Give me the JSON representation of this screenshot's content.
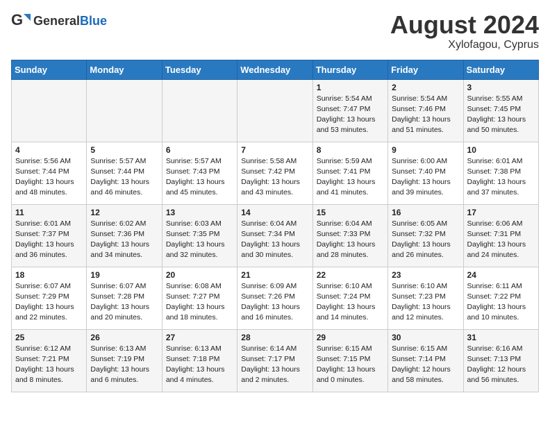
{
  "logo": {
    "general": "General",
    "blue": "Blue"
  },
  "title": "August 2024",
  "subtitle": "Xylofagou, Cyprus",
  "weekdays": [
    "Sunday",
    "Monday",
    "Tuesday",
    "Wednesday",
    "Thursday",
    "Friday",
    "Saturday"
  ],
  "weeks": [
    [
      {
        "day": "",
        "sunrise": "",
        "sunset": "",
        "daylight": ""
      },
      {
        "day": "",
        "sunrise": "",
        "sunset": "",
        "daylight": ""
      },
      {
        "day": "",
        "sunrise": "",
        "sunset": "",
        "daylight": ""
      },
      {
        "day": "",
        "sunrise": "",
        "sunset": "",
        "daylight": ""
      },
      {
        "day": "1",
        "sunrise": "5:54 AM",
        "sunset": "7:47 PM",
        "daylight": "13 hours and 53 minutes."
      },
      {
        "day": "2",
        "sunrise": "5:54 AM",
        "sunset": "7:46 PM",
        "daylight": "13 hours and 51 minutes."
      },
      {
        "day": "3",
        "sunrise": "5:55 AM",
        "sunset": "7:45 PM",
        "daylight": "13 hours and 50 minutes."
      }
    ],
    [
      {
        "day": "4",
        "sunrise": "5:56 AM",
        "sunset": "7:44 PM",
        "daylight": "13 hours and 48 minutes."
      },
      {
        "day": "5",
        "sunrise": "5:57 AM",
        "sunset": "7:44 PM",
        "daylight": "13 hours and 46 minutes."
      },
      {
        "day": "6",
        "sunrise": "5:57 AM",
        "sunset": "7:43 PM",
        "daylight": "13 hours and 45 minutes."
      },
      {
        "day": "7",
        "sunrise": "5:58 AM",
        "sunset": "7:42 PM",
        "daylight": "13 hours and 43 minutes."
      },
      {
        "day": "8",
        "sunrise": "5:59 AM",
        "sunset": "7:41 PM",
        "daylight": "13 hours and 41 minutes."
      },
      {
        "day": "9",
        "sunrise": "6:00 AM",
        "sunset": "7:40 PM",
        "daylight": "13 hours and 39 minutes."
      },
      {
        "day": "10",
        "sunrise": "6:01 AM",
        "sunset": "7:38 PM",
        "daylight": "13 hours and 37 minutes."
      }
    ],
    [
      {
        "day": "11",
        "sunrise": "6:01 AM",
        "sunset": "7:37 PM",
        "daylight": "13 hours and 36 minutes."
      },
      {
        "day": "12",
        "sunrise": "6:02 AM",
        "sunset": "7:36 PM",
        "daylight": "13 hours and 34 minutes."
      },
      {
        "day": "13",
        "sunrise": "6:03 AM",
        "sunset": "7:35 PM",
        "daylight": "13 hours and 32 minutes."
      },
      {
        "day": "14",
        "sunrise": "6:04 AM",
        "sunset": "7:34 PM",
        "daylight": "13 hours and 30 minutes."
      },
      {
        "day": "15",
        "sunrise": "6:04 AM",
        "sunset": "7:33 PM",
        "daylight": "13 hours and 28 minutes."
      },
      {
        "day": "16",
        "sunrise": "6:05 AM",
        "sunset": "7:32 PM",
        "daylight": "13 hours and 26 minutes."
      },
      {
        "day": "17",
        "sunrise": "6:06 AM",
        "sunset": "7:31 PM",
        "daylight": "13 hours and 24 minutes."
      }
    ],
    [
      {
        "day": "18",
        "sunrise": "6:07 AM",
        "sunset": "7:29 PM",
        "daylight": "13 hours and 22 minutes."
      },
      {
        "day": "19",
        "sunrise": "6:07 AM",
        "sunset": "7:28 PM",
        "daylight": "13 hours and 20 minutes."
      },
      {
        "day": "20",
        "sunrise": "6:08 AM",
        "sunset": "7:27 PM",
        "daylight": "13 hours and 18 minutes."
      },
      {
        "day": "21",
        "sunrise": "6:09 AM",
        "sunset": "7:26 PM",
        "daylight": "13 hours and 16 minutes."
      },
      {
        "day": "22",
        "sunrise": "6:10 AM",
        "sunset": "7:24 PM",
        "daylight": "13 hours and 14 minutes."
      },
      {
        "day": "23",
        "sunrise": "6:10 AM",
        "sunset": "7:23 PM",
        "daylight": "13 hours and 12 minutes."
      },
      {
        "day": "24",
        "sunrise": "6:11 AM",
        "sunset": "7:22 PM",
        "daylight": "13 hours and 10 minutes."
      }
    ],
    [
      {
        "day": "25",
        "sunrise": "6:12 AM",
        "sunset": "7:21 PM",
        "daylight": "13 hours and 8 minutes."
      },
      {
        "day": "26",
        "sunrise": "6:13 AM",
        "sunset": "7:19 PM",
        "daylight": "13 hours and 6 minutes."
      },
      {
        "day": "27",
        "sunrise": "6:13 AM",
        "sunset": "7:18 PM",
        "daylight": "13 hours and 4 minutes."
      },
      {
        "day": "28",
        "sunrise": "6:14 AM",
        "sunset": "7:17 PM",
        "daylight": "13 hours and 2 minutes."
      },
      {
        "day": "29",
        "sunrise": "6:15 AM",
        "sunset": "7:15 PM",
        "daylight": "13 hours and 0 minutes."
      },
      {
        "day": "30",
        "sunrise": "6:15 AM",
        "sunset": "7:14 PM",
        "daylight": "12 hours and 58 minutes."
      },
      {
        "day": "31",
        "sunrise": "6:16 AM",
        "sunset": "7:13 PM",
        "daylight": "12 hours and 56 minutes."
      }
    ]
  ]
}
